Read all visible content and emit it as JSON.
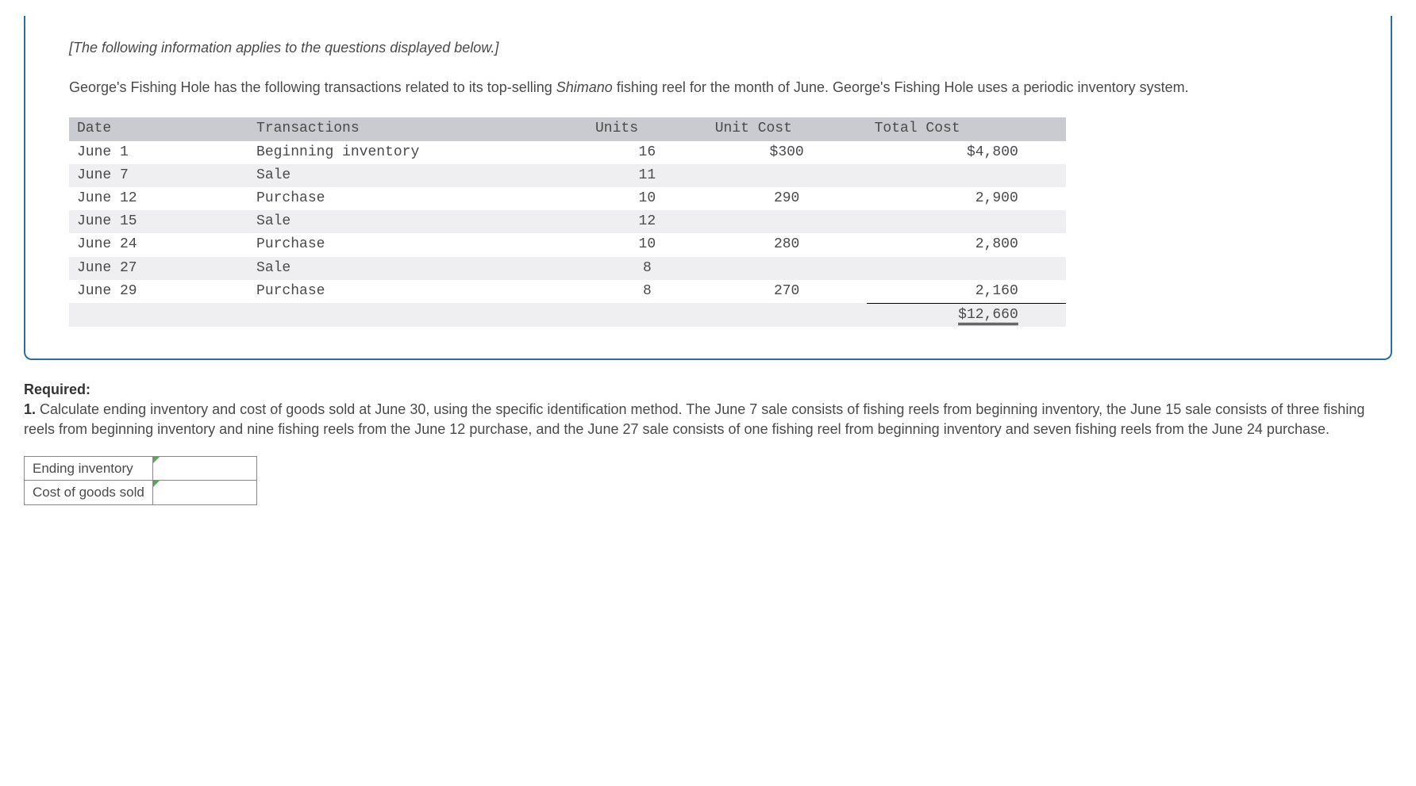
{
  "instruction": "[The following information applies to the questions displayed below.]",
  "intro_part1": "George's Fishing Hole has the following transactions related to its top-selling ",
  "intro_italic": "Shimano",
  "intro_part2": " fishing reel for the month of June. George's Fishing Hole uses a periodic inventory system.",
  "table": {
    "headers": [
      "Date",
      "Transactions",
      "Units",
      "Unit Cost",
      "Total Cost"
    ],
    "rows": [
      {
        "date": "June 1",
        "txn": "Beginning inventory",
        "units": "16",
        "unit_cost": "$300",
        "total": "$4,800"
      },
      {
        "date": "June 7",
        "txn": "Sale",
        "units": "11",
        "unit_cost": "",
        "total": ""
      },
      {
        "date": "June 12",
        "txn": "Purchase",
        "units": "10",
        "unit_cost": "290",
        "total": "2,900"
      },
      {
        "date": "June 15",
        "txn": "Sale",
        "units": "12",
        "unit_cost": "",
        "total": ""
      },
      {
        "date": "June 24",
        "txn": "Purchase",
        "units": "10",
        "unit_cost": "280",
        "total": "2,800"
      },
      {
        "date": "June 27",
        "txn": "Sale",
        "units": "8",
        "unit_cost": "",
        "total": ""
      },
      {
        "date": "June 29",
        "txn": "Purchase",
        "units": "8",
        "unit_cost": "270",
        "total": "2,160"
      }
    ],
    "grand_total": "$12,660"
  },
  "required_label": "Required:",
  "required_num": "1. ",
  "required_text": "Calculate ending inventory and cost of goods sold at June 30, using the specific identification method. The June 7 sale consists of fishing reels from beginning inventory, the June 15 sale consists of three fishing reels from beginning inventory and nine fishing reels from the June 12 purchase, and the June 27 sale consists of one fishing reel from beginning inventory and seven fishing reels from the June 24 purchase.",
  "answers": {
    "row1_label": "Ending inventory",
    "row2_label": "Cost of goods sold"
  }
}
